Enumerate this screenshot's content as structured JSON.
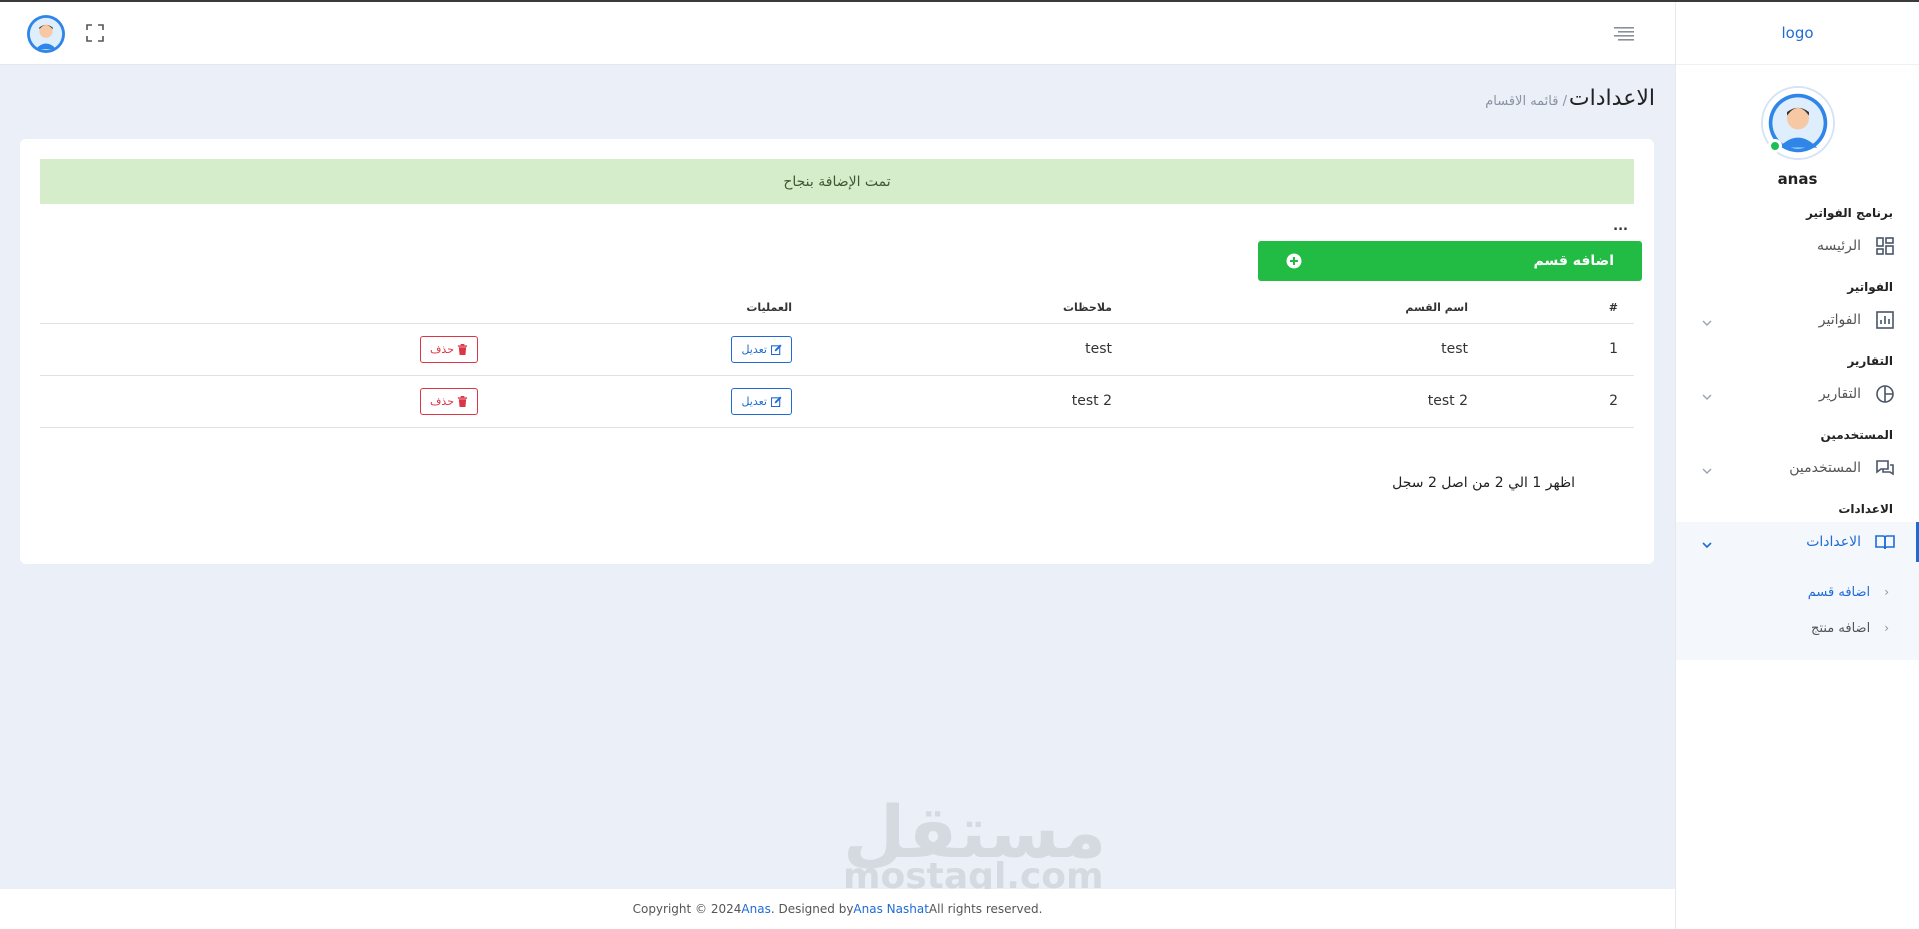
{
  "sidebar": {
    "logo_alt": "logo",
    "username": "anas",
    "sections": {
      "app": "برنامج الفواتير",
      "invoices": "الفواتير",
      "reports": "التقارير",
      "users": "المستخدمين",
      "settings": "الاعدادات"
    },
    "items": {
      "home": "الرئيسه",
      "invoices": "الفواتير",
      "reports": "التقارير",
      "users": "المستخدمين",
      "settings": "الاعدادات"
    },
    "sub_items": {
      "add_section": "اضافه قسم",
      "add_product": "اضافه منتج"
    }
  },
  "header": {
    "page_title": "الاعدادات",
    "breadcrumb": "/ قائمه الاقسام"
  },
  "alert": {
    "message": "تمت الإضافة بنجاح"
  },
  "toolbar": {
    "more": "...",
    "add_button": "اضافه قسم"
  },
  "table": {
    "headers": {
      "num": "#",
      "name": "اسم القسم",
      "notes": "ملاحظات",
      "ops": "العمليات"
    },
    "rows": [
      {
        "num": "1",
        "name": "test",
        "notes": "test",
        "edit": "تعديل",
        "delete": "حذف"
      },
      {
        "num": "2",
        "name": "test 2",
        "notes": "test 2",
        "edit": "تعديل",
        "delete": "حذف"
      }
    ],
    "pager": "اظهر 1 الي 2 من اصل 2 سجل"
  },
  "watermark": {
    "ar": "مستقل",
    "en": "mostaql.com"
  },
  "footer": {
    "prefix": "Copyright © 2024 ",
    "brand": "Anas",
    "designed": ". Designed by ",
    "designer": "Anas Nashat",
    "suffix": " All rights reserved."
  },
  "colors": {
    "primary": "#1f6bd6",
    "success": "#22bb44",
    "danger": "#dc3545",
    "alert_bg": "#d5edcb"
  }
}
